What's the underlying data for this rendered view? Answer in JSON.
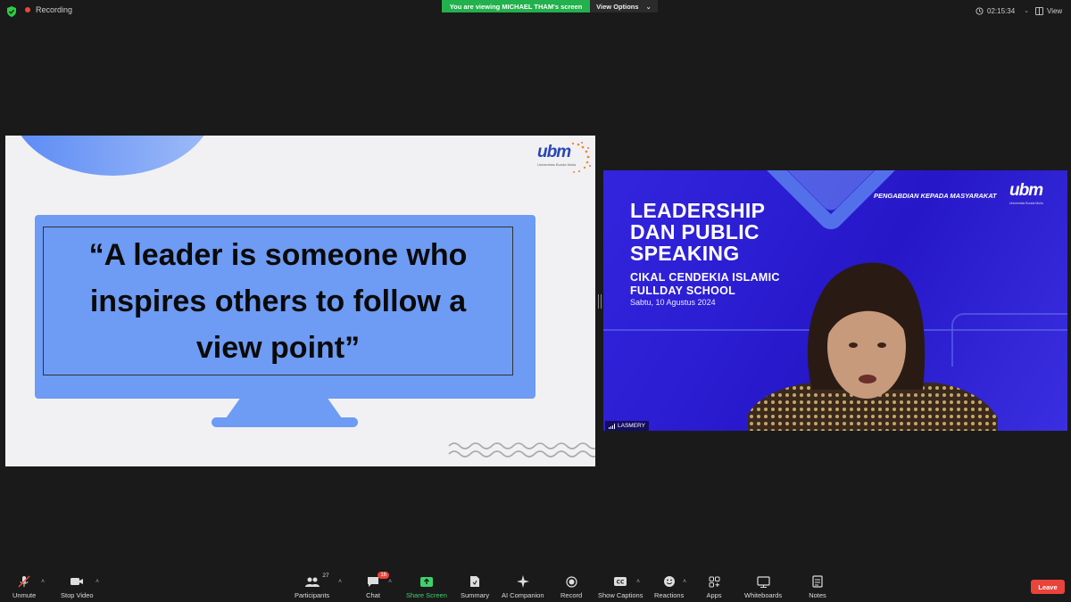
{
  "topbar": {
    "recording_label": "Recording",
    "viewing_banner": "You are viewing MICHAEL THAM's screen",
    "view_options_label": "View Options",
    "timer": "02:15:34",
    "view_label": "View"
  },
  "slide": {
    "logo_text": "ubm",
    "logo_subtitle": "Universitas Bunda Mulia",
    "quote": "“A leader is someone who inspires others to follow a view point”"
  },
  "speaker": {
    "title_line1": "LEADERSHIP",
    "title_line2": "DAN PUBLIC",
    "title_line3": "SPEAKING",
    "subtitle_line1": "CIKAL CENDEKIA ISLAMIC",
    "subtitle_line2": "FULLDAY SCHOOL",
    "date": "Sabtu, 10 Agustus 2024",
    "program": "PENGABDIAN KEPADA MASYARAKAT",
    "logo_text": "ubm",
    "logo_subtitle": "Universitas Bunda Mulia",
    "name": "LASMERY"
  },
  "toolbar": {
    "unmute": "Unmute",
    "stop_video": "Stop Video",
    "participants": "Participants",
    "participants_count": "27",
    "chat": "Chat",
    "chat_badge": "16",
    "share_screen": "Share Screen",
    "summary": "Summary",
    "ai_companion": "AI Companion",
    "record": "Record",
    "show_captions": "Show Captions",
    "reactions": "Reactions",
    "apps": "Apps",
    "whiteboards": "Whiteboards",
    "notes": "Notes",
    "leave": "Leave"
  },
  "colors": {
    "background": "#1a1a1a",
    "banner_green": "#22b14c",
    "leave_red": "#e84a3c",
    "slide_blue": "#6e9bf3",
    "video_blue": "#2b1fd8"
  }
}
